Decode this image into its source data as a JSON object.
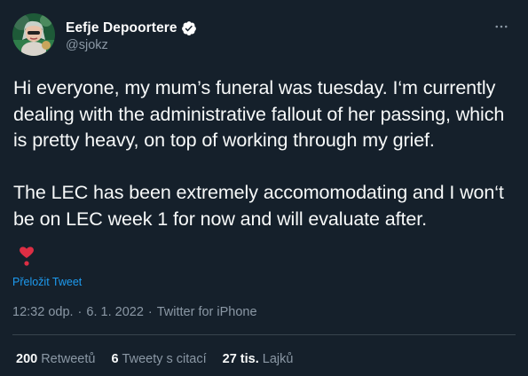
{
  "author": {
    "name": "Eefje Depoortere",
    "handle": "@sjokz",
    "verified": true,
    "accent_color": "#1d9bf0"
  },
  "tweet": {
    "text": "Hi everyone, my mum’s funeral was tuesday. I‘m currently dealing with the administrative fallout of her passing, which is pretty heavy, on top of working through my grief.\n\nThe LEC has been extremely accomomodating and I won‘t be on LEC week 1 for now and will evaluate after.",
    "emoji": "red-heart-exclamation",
    "translate_label": "Přeložit Tweet"
  },
  "meta": {
    "time": "12:32 odp.",
    "date": "6. 1. 2022",
    "source": "Twitter for iPhone",
    "separator": "·"
  },
  "stats": [
    {
      "value": "200",
      "label": "Retweetů"
    },
    {
      "value": "6",
      "label": "Tweety s citací"
    },
    {
      "value": "27 tis.",
      "label": "Lajků"
    }
  ],
  "more_icon": "more-horizontal-icon",
  "background_color": "#15202b"
}
